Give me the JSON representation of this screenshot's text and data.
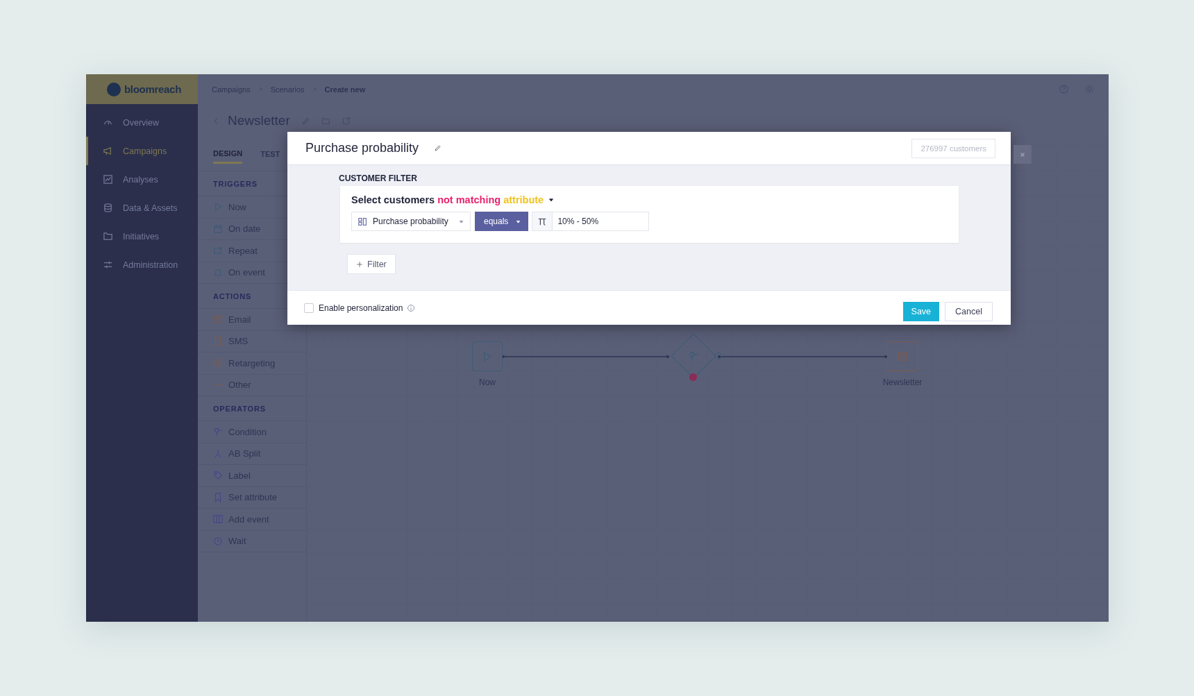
{
  "logo": "bloomreach",
  "nav": [
    {
      "label": "Overview",
      "selected": false
    },
    {
      "label": "Campaigns",
      "selected": true
    },
    {
      "label": "Analyses",
      "selected": false
    },
    {
      "label": "Data & Assets",
      "selected": false
    },
    {
      "label": "Initiatives",
      "selected": false
    },
    {
      "label": "Administration",
      "selected": false
    }
  ],
  "breadcrumbs": [
    "Campaigns",
    "Scenarios",
    "Create new"
  ],
  "scenario_title": "Newsletter",
  "tabs": [
    {
      "label": "DESIGN",
      "selected": true
    },
    {
      "label": "TEST",
      "selected": false
    }
  ],
  "palette": [
    {
      "heading": "TRIGGERS",
      "items": [
        {
          "label": "Now"
        },
        {
          "label": "On date"
        },
        {
          "label": "Repeat"
        },
        {
          "label": "On event"
        }
      ]
    },
    {
      "heading": "ACTIONS",
      "items": [
        {
          "label": "Email"
        },
        {
          "label": "SMS"
        },
        {
          "label": "Retargeting"
        },
        {
          "label": "Other"
        }
      ]
    },
    {
      "heading": "OPERATORS",
      "items": [
        {
          "label": "Condition"
        },
        {
          "label": "AB Split"
        },
        {
          "label": "Label"
        },
        {
          "label": "Set attribute"
        },
        {
          "label": "Add event"
        },
        {
          "label": "Wait"
        }
      ]
    }
  ],
  "canvas": {
    "nodes": [
      {
        "kind": "trigger",
        "label": "Now"
      },
      {
        "kind": "condition"
      },
      {
        "kind": "email",
        "label": "Newsletter"
      }
    ]
  },
  "modal": {
    "title": "Purchase probability",
    "count": "276997 customers",
    "section": "CUSTOMER FILTER",
    "sentence": {
      "lead": "Select customers",
      "negation": "not matching",
      "subject": "attribute"
    },
    "attribute": "Purchase probability",
    "operator": "equals",
    "value": "10% - 50%",
    "add_filter": "Filter",
    "personalization": {
      "label": "Enable personalization",
      "checked": false
    },
    "buttons": [
      {
        "label": "Save",
        "kind": "primary"
      },
      {
        "label": "Cancel",
        "kind": "secondary"
      }
    ]
  }
}
